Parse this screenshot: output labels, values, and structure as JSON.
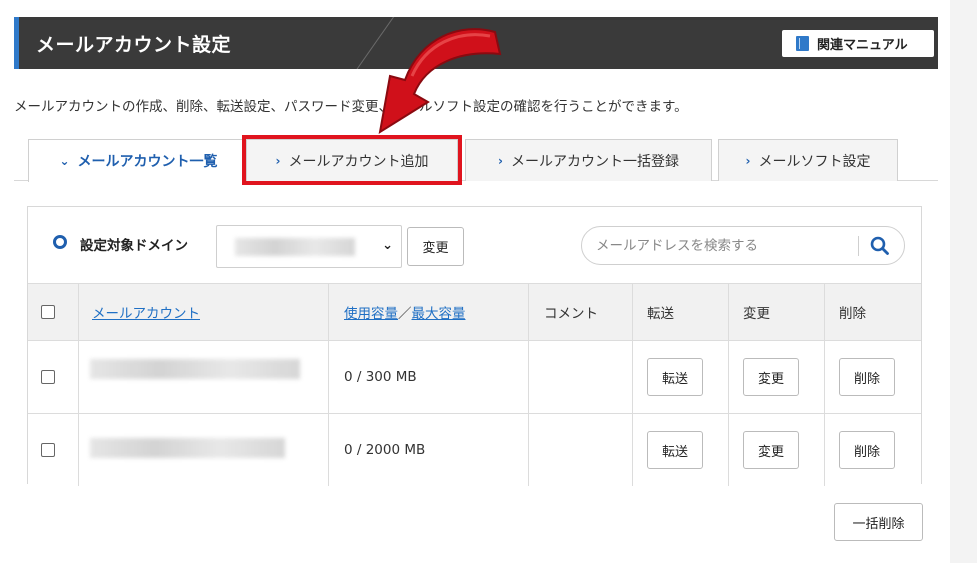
{
  "header": {
    "title": "メールアカウント設定",
    "manual_label": "関連マニュアル"
  },
  "description": "メールアカウントの作成、削除、転送設定、パスワード変更、メールソフト設定の確認を行うことができます。",
  "tabs": [
    {
      "label": "メールアカウント一覧",
      "state": "active"
    },
    {
      "label": "メールアカウント追加",
      "state": "highlighted"
    },
    {
      "label": "メールアカウント一括登録",
      "state": "normal"
    },
    {
      "label": "メールソフト設定",
      "state": "normal"
    }
  ],
  "filter": {
    "domain_label": "設定対象ドメイン",
    "change_label": "変更",
    "search_placeholder": "メールアドレスを検索する"
  },
  "table": {
    "headers": {
      "account": "メールアカウント",
      "usage": "使用容量",
      "separator": "／",
      "max": "最大容量",
      "comment": "コメント",
      "forward": "転送",
      "change": "変更",
      "delete": "削除"
    },
    "rows": [
      {
        "usage": "0 / 300 MB",
        "forward": "転送",
        "change": "変更",
        "delete": "削除"
      },
      {
        "usage": "0 / 2000 MB",
        "forward": "転送",
        "change": "変更",
        "delete": "削除"
      }
    ]
  },
  "bulk_delete_label": "一括削除",
  "colors": {
    "header_bg": "#3a3a3a",
    "accent_blue": "#2f79c9",
    "link_blue": "#1f6fc4",
    "highlight_red": "#e0141e"
  }
}
